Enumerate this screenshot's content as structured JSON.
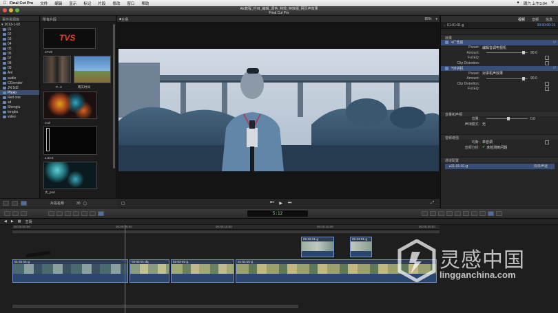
{
  "menubar": {
    "app_name": "Final Cut Pro",
    "items": [
      "文件",
      "编辑",
      "显示",
      "标记",
      "片段",
      "修改",
      "窗口",
      "帮助"
    ],
    "clock": "周六 上午3:04"
  },
  "window": {
    "title_top": "AE教程_栏目_编辑_调色_特效_特效组_网页声效果",
    "title_bottom": "Final Cut Pro"
  },
  "library": {
    "header": "事件资源库",
    "root": "2013-1-02",
    "events": [
      "01",
      "02",
      "03",
      "04",
      "05",
      "06",
      "07",
      "08",
      "09",
      "Anl",
      "audio",
      "CGrender",
      "JN 5d2",
      "Photo",
      "Red one",
      "sd",
      "Shengiu",
      "tongbu",
      "video"
    ],
    "selected": "Photo"
  },
  "browser": {
    "header": "所有片段",
    "labels": [
      "TVS",
      "1TVS",
      "P...3",
      "两天时间",
      "cool",
      "1:23.5",
      "大_pod"
    ],
    "footer_label": "片段名称",
    "footer_count": "30"
  },
  "viewer": {
    "header": "主场",
    "zoom": "85%"
  },
  "inspector": {
    "tabs": [
      "视频",
      "音频",
      "信息"
    ],
    "clip_name": "01-01-01-g",
    "clip_timecode": "00:00:00:19",
    "section_effects": "效果",
    "effect1": {
      "title": "广告前",
      "preset_label": "Preset:",
      "preset_value": "编辑音调电视机",
      "amount_label": "Amount:",
      "amount_value": "90.0",
      "fuleq_label": "Ful EQ:",
      "clip_label": "Clip Distortion:"
    },
    "effect2": {
      "title": "对讲机",
      "preset_label": "Preset:",
      "preset_value": "对讲机声效果",
      "amount_label": "Amount:",
      "amount_value": "90.0",
      "clip_label": "Clip Distortion:",
      "fuleq_label": "Ful EQ:"
    },
    "section_volume": "音量和声相",
    "volume_label": "音量:",
    "volume_value": "0.0",
    "pan_label": "声相模式:",
    "pan_value": "无",
    "section_enhance": "音频增强",
    "eq_label": "均衡:",
    "eq_value": "单音调",
    "analysis_label": "音频分析:",
    "analysis_value": "未检测到问题",
    "section_channels": "通道配置",
    "channel_clip": "01-01-01-g",
    "channel_value": "双单声道"
  },
  "timeline": {
    "timecode": "5:12",
    "index_label": "主场",
    "ruler": [
      "00:00:00:00",
      "00:00:05:00",
      "00:00:10:00",
      "00:00:15:00",
      "00:00:20:00"
    ],
    "clips": [
      "01-01-01-g",
      "03-03-01-dq",
      "03-03-01-g",
      "01-01-01-g",
      "05-03-01-g",
      "05-03-01-g"
    ]
  },
  "watermark": {
    "cn": "灵感中国",
    "en": "lingganchina.com"
  }
}
